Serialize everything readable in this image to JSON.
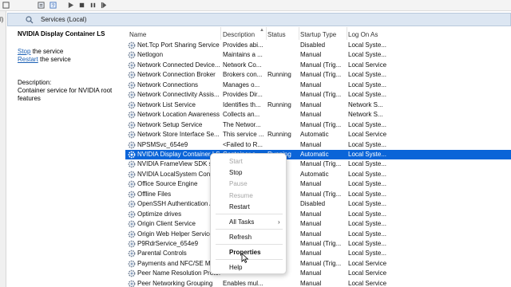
{
  "left_strip_text": "l)",
  "header": {
    "title": "Services (Local)"
  },
  "details": {
    "service_title": "NVIDIA Display Container LS",
    "actions": [
      {
        "link": "Stop",
        "suffix": " the service"
      },
      {
        "link": "Restart",
        "suffix": " the service"
      }
    ],
    "description_label": "Description:",
    "description_text": "Container service for NVIDIA root features"
  },
  "columns": [
    "Name",
    "Description",
    "Status",
    "Startup Type",
    "Log On As"
  ],
  "rows": [
    {
      "name": "Net.Tcp Port Sharing Service",
      "description": "Provides abi...",
      "status": "",
      "startup": "Disabled",
      "logon": "Local Syste..."
    },
    {
      "name": "Netlogon",
      "description": "Maintains a ...",
      "status": "",
      "startup": "Manual",
      "logon": "Local Syste..."
    },
    {
      "name": "Network Connected Device...",
      "description": "Network Co...",
      "status": "",
      "startup": "Manual (Trig...",
      "logon": "Local Service"
    },
    {
      "name": "Network Connection Broker",
      "description": "Brokers con...",
      "status": "Running",
      "startup": "Manual (Trig...",
      "logon": "Local Syste..."
    },
    {
      "name": "Network Connections",
      "description": "Manages o...",
      "status": "",
      "startup": "Manual",
      "logon": "Local Syste..."
    },
    {
      "name": "Network Connectivity Assis...",
      "description": "Provides Dir...",
      "status": "",
      "startup": "Manual (Trig...",
      "logon": "Local Syste..."
    },
    {
      "name": "Network List Service",
      "description": "Identifies th...",
      "status": "Running",
      "startup": "Manual",
      "logon": "Network S..."
    },
    {
      "name": "Network Location Awareness",
      "description": "Collects an...",
      "status": "",
      "startup": "Manual",
      "logon": "Network S..."
    },
    {
      "name": "Network Setup Service",
      "description": "The Networ...",
      "status": "",
      "startup": "Manual (Trig...",
      "logon": "Local Syste..."
    },
    {
      "name": "Network Store Interface Se...",
      "description": "This service ...",
      "status": "Running",
      "startup": "Automatic",
      "logon": "Local Service"
    },
    {
      "name": "NPSMSvc_654e9",
      "description": "<Failed to R...",
      "status": "",
      "startup": "Manual",
      "logon": "Local Syste..."
    },
    {
      "name": "NVIDIA Display Container LS",
      "description": "Container s...",
      "status": "Running",
      "startup": "Automatic",
      "logon": "Local Syste...",
      "selected": true
    },
    {
      "name": "NVIDIA FrameView SDK service",
      "description": "",
      "status": "",
      "startup": "Manual (Trig...",
      "logon": "Local Syste..."
    },
    {
      "name": "NVIDIA LocalSystem Container",
      "description": "",
      "status": "",
      "startup": "Automatic",
      "logon": "Local Syste..."
    },
    {
      "name": "Office Source Engine",
      "description": "",
      "status": "",
      "startup": "Manual",
      "logon": "Local Syste..."
    },
    {
      "name": "Offline Files",
      "description": "",
      "status": "",
      "startup": "Manual (Trig...",
      "logon": "Local Syste..."
    },
    {
      "name": "OpenSSH Authentication Agent",
      "description": "",
      "status": "",
      "startup": "Disabled",
      "logon": "Local Syste..."
    },
    {
      "name": "Optimize drives",
      "description": "",
      "status": "",
      "startup": "Manual",
      "logon": "Local Syste..."
    },
    {
      "name": "Origin Client Service",
      "description": "",
      "status": "",
      "startup": "Manual",
      "logon": "Local Syste..."
    },
    {
      "name": "Origin Web Helper Service",
      "description": "",
      "status": "",
      "startup": "Manual",
      "logon": "Local Syste..."
    },
    {
      "name": "P9RdrService_654e9",
      "description": "",
      "status": "",
      "startup": "Manual (Trig...",
      "logon": "Local Syste..."
    },
    {
      "name": "Parental Controls",
      "description": "",
      "status": "",
      "startup": "Manual",
      "logon": "Local Syste..."
    },
    {
      "name": "Payments and NFC/SE Manager",
      "description": "",
      "status": "",
      "startup": "Manual (Trig...",
      "logon": "Local Service"
    },
    {
      "name": "Peer Name Resolution Proto...",
      "description": "",
      "status": "",
      "startup": "Manual",
      "logon": "Local Service"
    },
    {
      "name": "Peer Networking Grouping",
      "description": "Enables mul...",
      "status": "",
      "startup": "Manual",
      "logon": "Local Service"
    }
  ],
  "context_menu": {
    "items": [
      {
        "label": "Start",
        "enabled": false
      },
      {
        "label": "Stop",
        "enabled": true
      },
      {
        "label": "Pause",
        "enabled": false
      },
      {
        "label": "Resume",
        "enabled": false
      },
      {
        "label": "Restart",
        "enabled": true
      },
      {
        "label": "All Tasks",
        "enabled": true,
        "submenu": true
      },
      {
        "label": "Refresh",
        "enabled": true
      },
      {
        "label": "Properties",
        "enabled": true,
        "bold": true
      },
      {
        "label": "Help",
        "enabled": true
      }
    ],
    "submenu_arrow": "›"
  },
  "colors": {
    "selection": "#0a64d8",
    "header_bg": "#dce6f2",
    "link": "#1a5fb4",
    "disabled": "#a6a6a6"
  },
  "icons": {
    "toolbar": [
      "properties-icon",
      "help-icon",
      "play-icon",
      "stop-icon",
      "pause-icon",
      "restart-icon"
    ],
    "service": "gear-icon"
  }
}
